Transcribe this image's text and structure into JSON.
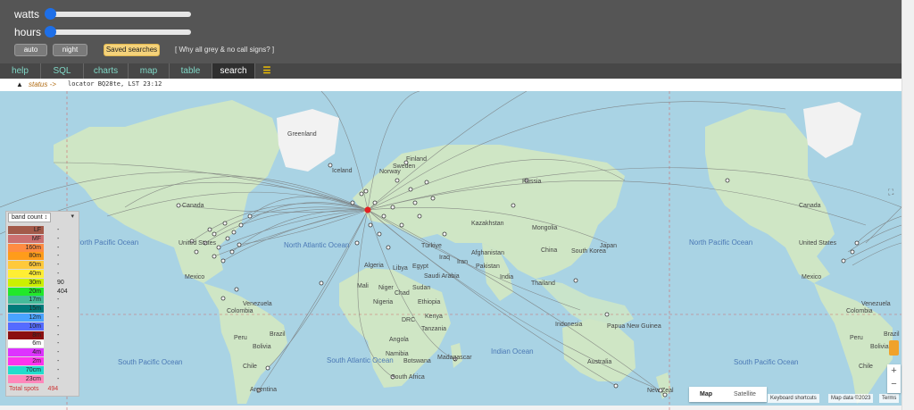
{
  "sliders": [
    {
      "label": "watts",
      "value": 0
    },
    {
      "label": "hours",
      "value": 0
    }
  ],
  "buttons": {
    "auto": "auto",
    "night": "night",
    "saved": "Saved searches"
  },
  "why_grey": "[ Why all grey & no call signs? ]",
  "tabs": [
    "help",
    "SQL",
    "charts",
    "map",
    "table",
    "search",
    "☰"
  ],
  "active_tab": "search",
  "status": {
    "arrow": "▲",
    "link": "status ->",
    "text": "locator BQ28te, LST 23:12"
  },
  "legend": {
    "header": "band count ↕",
    "filter_icon": "▾",
    "bands": [
      {
        "band": "LF",
        "count": "-",
        "color": "#a35a4a"
      },
      {
        "band": "MF",
        "count": "-",
        "color": "#cc7070"
      },
      {
        "band": "160m",
        "count": "-",
        "color": "#ff8c42"
      },
      {
        "band": "80m",
        "count": "-",
        "color": "#ff9c1a"
      },
      {
        "band": "60m",
        "count": "-",
        "color": "#ffc93b"
      },
      {
        "band": "40m",
        "count": "-",
        "color": "#ffee33"
      },
      {
        "band": "30m",
        "count": "90",
        "color": "#ccf000"
      },
      {
        "band": "20m",
        "count": "404",
        "color": "#22e82a"
      },
      {
        "band": "17m",
        "count": "-",
        "color": "#45bb9a"
      },
      {
        "band": "15m",
        "count": "-",
        "color": "#007b7b"
      },
      {
        "band": "12m",
        "count": "-",
        "color": "#49a3ff"
      },
      {
        "band": "10m",
        "count": "-",
        "color": "#556bff"
      },
      {
        "band": "8m",
        "count": "-",
        "color": "#8b1010"
      },
      {
        "band": "6m",
        "count": "-",
        "color": "#ffffff"
      },
      {
        "band": "4m",
        "count": "-",
        "color": "#dd33ff"
      },
      {
        "band": "2m",
        "count": "-",
        "color": "#ff33ee"
      },
      {
        "band": "70cm",
        "count": "-",
        "color": "#22ddcc"
      },
      {
        "band": "23cm",
        "count": "-",
        "color": "#ff88bb"
      }
    ],
    "total_label": "Total spots",
    "total_value": "494"
  },
  "map_labels": {
    "greenland": "Greenland",
    "iceland": "Iceland",
    "canada": "Canada",
    "canada2": "Canada",
    "united_states": "United States",
    "united_states2": "United States",
    "mexico": "Mexico",
    "mexico2": "Mexico",
    "venezuela": "Venezuela",
    "venezuela2": "Venezuela",
    "colombia": "Colombia",
    "colombia2": "Colombia",
    "peru": "Peru",
    "peru2": "Peru",
    "bolivia": "Bolivia",
    "bolivia2": "Bolivia",
    "brazil": "Brazil",
    "brazil2": "Brazil",
    "chile": "Chile",
    "chile2": "Chile",
    "argentina": "Argentina",
    "finland": "Finland",
    "sweden": "Sweden",
    "norway": "Norway",
    "russia": "Russia",
    "kazakhstan": "Kazakhstan",
    "mongolia": "Mongolia",
    "china": "China",
    "japan": "Japan",
    "south_korea": "South Korea",
    "turkiye": "Türkiye",
    "iraq": "Iraq",
    "iran": "Iran",
    "afghanistan": "Afghanistan",
    "pakistan": "Pakistan",
    "india": "India",
    "thailand": "Thailand",
    "indonesia": "Indonesia",
    "papua_new_guinea": "Papua New Guinea",
    "australia": "Australia",
    "new_zealand": "New Zeal",
    "algeria": "Algeria",
    "libya": "Libya",
    "egypt": "Egypt",
    "saudi_arabia": "Saudi Arabia",
    "mali": "Mali",
    "niger": "Niger",
    "chad": "Chad",
    "sudan": "Sudan",
    "nigeria": "Nigeria",
    "ethiopia": "Ethiopia",
    "drc": "DRC",
    "kenya": "Kenya",
    "tanzania": "Tanzania",
    "angola": "Angola",
    "namibia": "Namibia",
    "madagascar": "Madagascar",
    "south_africa": "South Africa",
    "botswana": "Botswana"
  },
  "oceans": {
    "north_pacific": "North Pacific Ocean",
    "north_pacific2": "North Pacific Ocean",
    "north_atlantic": "North Atlantic Ocean",
    "south_pacific": "South Pacific Ocean",
    "south_pacific2": "South Pacific Ocean",
    "south_atlantic": "South Atlantic Ocean",
    "indian": "Indian Ocean"
  },
  "map_controls": {
    "map": "Map",
    "satellite": "Satellite",
    "keyboard": "Keyboard shortcuts",
    "data": "Map data ©2023",
    "terms": "Terms",
    "zoom_in": "+",
    "zoom_out": "−",
    "fullscreen_icon": "⛶"
  }
}
